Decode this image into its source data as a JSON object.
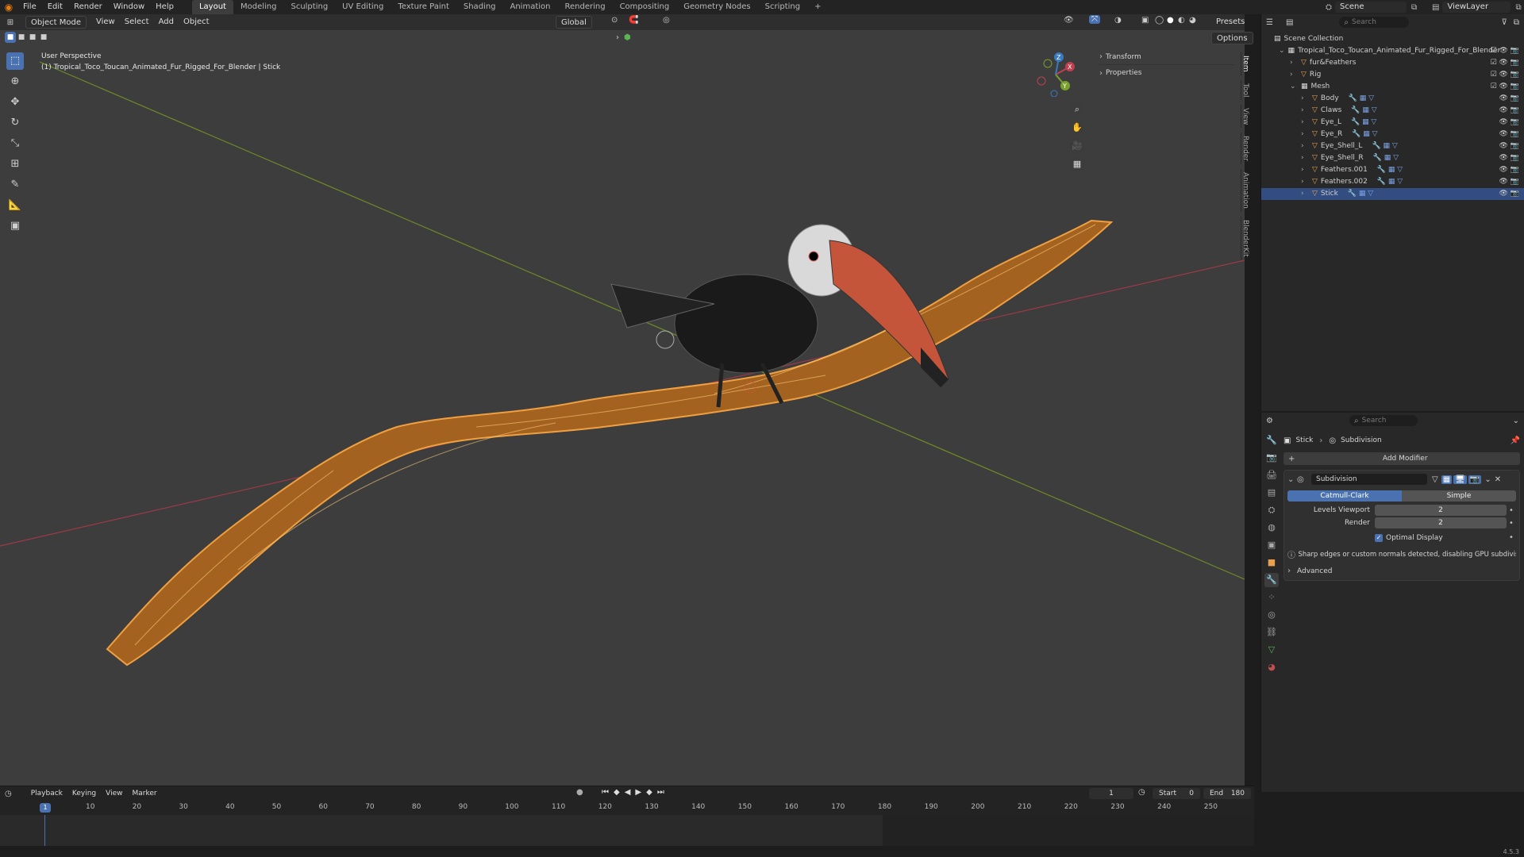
{
  "topbar": {
    "menus": [
      "File",
      "Edit",
      "Render",
      "Window",
      "Help"
    ],
    "workspaces": [
      "Layout",
      "Modeling",
      "Sculpting",
      "UV Editing",
      "Texture Paint",
      "Shading",
      "Animation",
      "Rendering",
      "Compositing",
      "Geometry Nodes",
      "Scripting"
    ],
    "active_workspace": "Layout",
    "add_tab": "+",
    "scene": "Scene",
    "view_layer": "ViewLayer"
  },
  "viewport": {
    "mode": "Object Mode",
    "menus": [
      "View",
      "Select",
      "Add",
      "Object"
    ],
    "orientation": "Global",
    "presets": "Presets",
    "options": "Options",
    "perspective": "User Perspective",
    "object_info": "(1) Tropical_Toco_Toucan_Animated_Fur_Rigged_For_Blender | Stick",
    "sidebar_panels": [
      "Transform",
      "Properties"
    ],
    "sidebar_tabs": [
      "Item",
      "Tool",
      "View",
      "Render",
      "Animation",
      "BlenderKit"
    ],
    "gizmo_labels": {
      "x": "X",
      "y": "Y",
      "z": "Z"
    }
  },
  "outliner": {
    "search_placeholder": "Search",
    "root": "Scene Collection",
    "collection": "Tropical_Toco_Toucan_Animated_Fur_Rigged_For_Blender",
    "items": [
      {
        "label": "fur&Feathers",
        "depth": 1,
        "icon": "object-icon"
      },
      {
        "label": "Rig",
        "depth": 1,
        "icon": "armature-icon"
      },
      {
        "label": "Mesh",
        "depth": 1,
        "icon": "collection-icon"
      },
      {
        "label": "Body",
        "depth": 2,
        "icon": "mesh-icon"
      },
      {
        "label": "Claws",
        "depth": 2,
        "icon": "mesh-icon"
      },
      {
        "label": "Eye_L",
        "depth": 2,
        "icon": "mesh-icon"
      },
      {
        "label": "Eye_R",
        "depth": 2,
        "icon": "mesh-icon"
      },
      {
        "label": "Eye_Shell_L",
        "depth": 2,
        "icon": "mesh-icon"
      },
      {
        "label": "Eye_Shell_R",
        "depth": 2,
        "icon": "mesh-icon"
      },
      {
        "label": "Feathers.001",
        "depth": 2,
        "icon": "mesh-icon"
      },
      {
        "label": "Feathers.002",
        "depth": 2,
        "icon": "mesh-icon"
      },
      {
        "label": "Stick",
        "depth": 2,
        "icon": "mesh-icon",
        "selected": true
      }
    ]
  },
  "properties": {
    "search_placeholder": "Search",
    "breadcrumb_object": "Stick",
    "breadcrumb_modifier": "Subdivision",
    "add_modifier": "Add Modifier",
    "modifier_name": "Subdivision",
    "algorithms": [
      "Catmull-Clark",
      "Simple"
    ],
    "active_algorithm": "Catmull-Clark",
    "levels_viewport_label": "Levels Viewport",
    "levels_viewport": "2",
    "render_label": "Render",
    "render_levels": "2",
    "optimal_display": "Optimal Display",
    "warning": "Sharp edges or custom normals detected, disabling GPU subdivis...",
    "advanced": "Advanced"
  },
  "timeline": {
    "menus": [
      "Playback",
      "Keying",
      "View",
      "Marker"
    ],
    "current_frame": "1",
    "start_label": "Start",
    "start": "0",
    "end_label": "End",
    "end": "180",
    "ticks": [
      "10",
      "20",
      "30",
      "40",
      "50",
      "60",
      "70",
      "80",
      "90",
      "100",
      "110",
      "120",
      "130",
      "140",
      "150",
      "160",
      "170",
      "180",
      "190",
      "200",
      "210",
      "220",
      "230",
      "240",
      "250"
    ],
    "playhead": "1"
  },
  "statusbar": {
    "version": "4.5.3"
  },
  "colors": {
    "accent": "#4a72b0",
    "selection": "#334d80",
    "wireframe": "#f0a040",
    "x_axis": "#b03a4a",
    "y_axis": "#7a9a2a"
  }
}
